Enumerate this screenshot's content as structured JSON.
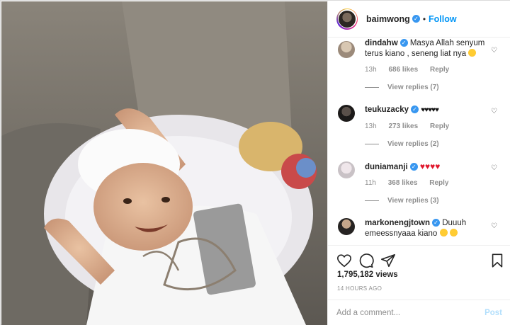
{
  "post": {
    "author": {
      "username": "baimwong",
      "verified": true
    },
    "header_sep": "•",
    "follow_label": "Follow"
  },
  "comments": [
    {
      "username": "dindahw",
      "verified": true,
      "text": "Masya Allah senyum terus kiano , seneng liat nya",
      "emoji_icon": "grinning-face-icon",
      "time": "13h",
      "likes": "686 likes",
      "reply_label": "Reply",
      "view_replies": "View replies (7)"
    },
    {
      "username": "teukuzacky",
      "verified": true,
      "text": "♥♥♥♥♥",
      "time": "13h",
      "likes": "273 likes",
      "reply_label": "Reply",
      "view_replies": "View replies (2)"
    },
    {
      "username": "duniamanji",
      "verified": true,
      "text": "♥♥♥♥",
      "time": "11h",
      "likes": "368 likes",
      "reply_label": "Reply",
      "view_replies": "View replies (3)"
    },
    {
      "username": "markonengjtown",
      "verified": true,
      "text": "Duuuh emeessnyaaa kiano",
      "emoji_icon": "grinning-face-icon"
    }
  ],
  "stats": {
    "views": "1,795,182 views",
    "posted": "14 HOURS AGO"
  },
  "composer": {
    "placeholder": "Add a comment...",
    "post_label": "Post"
  },
  "icons": {
    "like": "heart-icon",
    "comment": "comment-bubble-icon",
    "share": "paper-plane-icon",
    "save": "bookmark-icon"
  },
  "colors": {
    "accent": "#0095f6",
    "verified": "#3897f0",
    "post_disabled": "#b2dffc",
    "red_heart": "#e0182d"
  }
}
